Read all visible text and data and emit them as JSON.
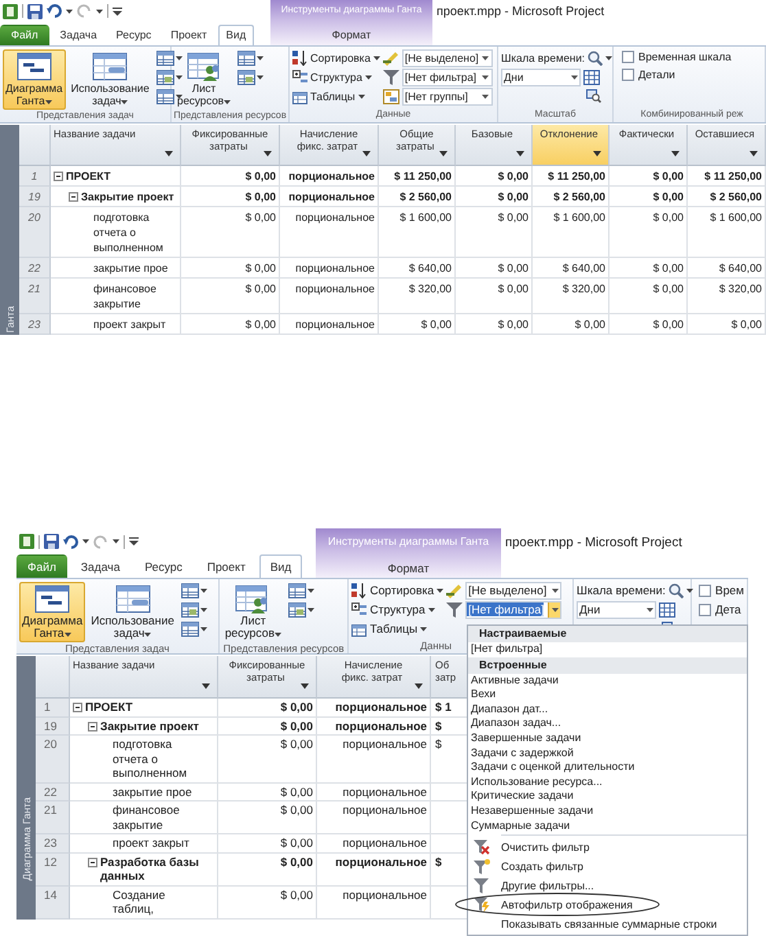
{
  "screens": [
    {
      "title_bar": {
        "context_header": "Инструменты диаграммы Ганта",
        "title": "проект.mpp  -  Microsoft Project"
      },
      "tabs": [
        {
          "label": "Файл",
          "kind": "file",
          "selected": false
        },
        {
          "label": "Задача",
          "kind": "tab",
          "selected": false
        },
        {
          "label": "Ресурс",
          "kind": "tab",
          "selected": false
        },
        {
          "label": "Проект",
          "kind": "tab",
          "selected": false
        },
        {
          "label": "Вид",
          "kind": "tab",
          "selected": true
        },
        {
          "label": "Формат",
          "kind": "context",
          "selected": false
        }
      ],
      "ribbon": [
        {
          "kind": "task_views",
          "label": "Представления задач",
          "buttons": [
            {
              "label": "Диаграмма\nГанта",
              "selected": true
            },
            {
              "label": "Использование\nзадач",
              "selected": false
            }
          ]
        },
        {
          "kind": "resource_views",
          "label": "Представления ресурсов",
          "buttons": [
            {
              "label": "Лист\nресурсов",
              "selected": false
            }
          ]
        },
        {
          "kind": "data",
          "label": "Данные",
          "commands": [
            "Сортировка",
            "Структура",
            "Таблицы"
          ],
          "combos": [
            {
              "value": "[Не выделено]",
              "open": false
            },
            {
              "value": "[Нет фильтра]",
              "open": false
            },
            {
              "value": "[Нет группы]",
              "open": false
            }
          ]
        },
        {
          "kind": "zoom",
          "label": "Масштаб",
          "timescale_label": "Шкала времени:",
          "timescale_value": "Дни"
        },
        {
          "kind": "combined",
          "label": "Комбинированный реж",
          "checkboxes": [
            {
              "label": "Временная шкала",
              "checked": false
            },
            {
              "label": "Детали",
              "checked": false
            }
          ]
        }
      ],
      "side_label": "Ганта",
      "table": {
        "columns": [
          {
            "label": "Название задачи",
            "kind": "name",
            "highlighted": false
          },
          {
            "label": "Фиксированные\nзатраты",
            "kind": "number",
            "highlighted": false
          },
          {
            "label": "Начисление\nфикс. затрат",
            "kind": "number",
            "highlighted": false
          },
          {
            "label": "Общие\nзатраты",
            "kind": "number",
            "highlighted": false
          },
          {
            "label": "Базовые",
            "kind": "number",
            "highlighted": false
          },
          {
            "label": "Отклонение",
            "kind": "number",
            "highlighted": true
          },
          {
            "label": "Фактически",
            "kind": "number",
            "highlighted": false
          },
          {
            "label": "Оставшиеся",
            "kind": "number",
            "highlighted": false
          }
        ],
        "rows": [
          {
            "id": "1",
            "expanded": true,
            "cells": [
              "ПРОЕКТ",
              "$ 0,00",
              "порциональное",
              "$ 11 250,00",
              "$ 0,00",
              "$ 11 250,00",
              "$ 0,00",
              "$ 11 250,00"
            ],
            "children": [
              {
                "id": "19",
                "expanded": true,
                "cells": [
                  "Закрытие проект",
                  "$ 0,00",
                  "порциональное",
                  "$ 2 560,00",
                  "$ 0,00",
                  "$ 2 560,00",
                  "$ 0,00",
                  "$ 2 560,00"
                ],
                "children": [
                  {
                    "id": "20",
                    "cells": [
                      "подготовка\nотчета о\nвыполненном",
                      "$ 0,00",
                      "порциональное",
                      "$ 1 600,00",
                      "$ 0,00",
                      "$ 1 600,00",
                      "$ 0,00",
                      "$ 1 600,00"
                    ]
                  },
                  {
                    "id": "22",
                    "cells": [
                      "закрытие прое",
                      "$ 0,00",
                      "порциональное",
                      "$ 640,00",
                      "$ 0,00",
                      "$ 640,00",
                      "$ 0,00",
                      "$ 640,00"
                    ]
                  },
                  {
                    "id": "21",
                    "cells": [
                      "финансовое\nзакрытие",
                      "$ 0,00",
                      "порциональное",
                      "$ 320,00",
                      "$ 0,00",
                      "$ 320,00",
                      "$ 0,00",
                      "$ 320,00"
                    ]
                  },
                  {
                    "id": "23",
                    "cells": [
                      "проект закрыт",
                      "$ 0,00",
                      "порциональное",
                      "$ 0,00",
                      "$ 0,00",
                      "$ 0,00",
                      "$ 0,00",
                      "$ 0,00"
                    ]
                  }
                ]
              }
            ]
          }
        ]
      }
    },
    {
      "title_bar": {
        "context_header": "Инструменты диаграммы Ганта",
        "title": "проект.mpp  -  Microsoft Project"
      },
      "tabs": [
        {
          "label": "Файл",
          "kind": "file",
          "selected": false
        },
        {
          "label": "Задача",
          "kind": "tab",
          "selected": false
        },
        {
          "label": "Ресурс",
          "kind": "tab",
          "selected": false
        },
        {
          "label": "Проект",
          "kind": "tab",
          "selected": false
        },
        {
          "label": "Вид",
          "kind": "tab",
          "selected": true
        },
        {
          "label": "Формат",
          "kind": "context",
          "selected": false
        }
      ],
      "ribbon": [
        {
          "kind": "task_views",
          "label": "Представления задач",
          "buttons": [
            {
              "label": "Диаграмма\nГанта",
              "selected": true
            },
            {
              "label": "Использование\nзадач",
              "selected": false
            }
          ]
        },
        {
          "kind": "resource_views",
          "label": "Представления ресурсов",
          "buttons": [
            {
              "label": "Лист\nресурсов",
              "selected": false
            }
          ]
        },
        {
          "kind": "data",
          "label": "Данны",
          "commands": [
            "Сортировка",
            "Структура",
            "Таблицы"
          ],
          "combos": [
            {
              "value": "[Не выделено]",
              "open": false
            },
            {
              "value": "[Нет фильтра]",
              "open": true
            }
          ]
        },
        {
          "kind": "zoom",
          "timescale_label": "Шкала времени:",
          "timescale_value": "Дни"
        },
        {
          "kind": "combined",
          "checkboxes": [
            {
              "label": "Врем",
              "checked": false
            },
            {
              "label": "Дета",
              "checked": false
            }
          ]
        }
      ],
      "side_label": "Диаграмма Ганта",
      "table": {
        "columns": [
          {
            "label": "Название задачи",
            "kind": "name",
            "highlighted": false
          },
          {
            "label": "Фиксированные\nзатраты",
            "kind": "number",
            "highlighted": false
          },
          {
            "label": "Начисление\nфикс. затрат",
            "kind": "number",
            "highlighted": false
          },
          {
            "label": "Об\nзатр",
            "kind": "clipped",
            "highlighted": false
          }
        ],
        "rows": [
          {
            "id": "1",
            "expanded": true,
            "cells": [
              "ПРОЕКТ",
              "$ 0,00",
              "порциональное",
              "$ 1"
            ],
            "children": [
              {
                "id": "19",
                "expanded": true,
                "cells": [
                  "Закрытие проект",
                  "$ 0,00",
                  "порциональное",
                  "$"
                ],
                "children": [
                  {
                    "id": "20",
                    "cells": [
                      "подготовка\nотчета о\nвыполненном",
                      "$ 0,00",
                      "порциональное",
                      "$"
                    ]
                  },
                  {
                    "id": "22",
                    "cells": [
                      "закрытие прое",
                      "$ 0,00",
                      "порциональное"
                    ]
                  },
                  {
                    "id": "21",
                    "cells": [
                      "финансовое\nзакрытие",
                      "$ 0,00",
                      "порциональное"
                    ]
                  },
                  {
                    "id": "23",
                    "cells": [
                      "проект закрыт",
                      "$ 0,00",
                      "порциональное"
                    ]
                  }
                ]
              },
              {
                "id": "12",
                "expanded": true,
                "cells": [
                  "Разработка базы\nданных",
                  "$ 0,00",
                  "порциональное",
                  "$"
                ],
                "children": [
                  {
                    "id": "14",
                    "cells": [
                      "Создание\nтаблиц,",
                      "$ 0,00",
                      "порциональное"
                    ]
                  }
                ]
              }
            ]
          }
        ]
      },
      "filter_menu": {
        "items": [
          {
            "kind": "header",
            "label": "Настраиваемые"
          },
          {
            "kind": "item",
            "label": "[Нет фильтра]"
          },
          {
            "kind": "header",
            "label": "Встроенные"
          },
          {
            "kind": "item",
            "label": "Активные задачи"
          },
          {
            "kind": "item",
            "label": "Вехи"
          },
          {
            "kind": "item",
            "label": "Диапазон дат..."
          },
          {
            "kind": "item",
            "label": "Диапазон задач..."
          },
          {
            "kind": "item",
            "label": "Завершенные задачи"
          },
          {
            "kind": "item",
            "label": "Задачи с задержкой"
          },
          {
            "kind": "item",
            "label": "Задачи с оценкой длительности"
          },
          {
            "kind": "item",
            "label": "Использование ресурса..."
          },
          {
            "kind": "item",
            "label": "Критические задачи"
          },
          {
            "kind": "item",
            "label": "Незавершенные задачи"
          },
          {
            "kind": "item",
            "label": "Суммарные задачи"
          },
          {
            "kind": "clear",
            "label": "Очистить фильтр"
          },
          {
            "kind": "new",
            "label": "Создать фильтр"
          },
          {
            "kind": "more",
            "label": "Другие фильтры..."
          },
          {
            "kind": "autofilter",
            "label": "Автофильтр отображения",
            "circled": true
          },
          {
            "kind": "toggle",
            "label": "Показывать связанные суммарные строки"
          }
        ]
      }
    }
  ]
}
